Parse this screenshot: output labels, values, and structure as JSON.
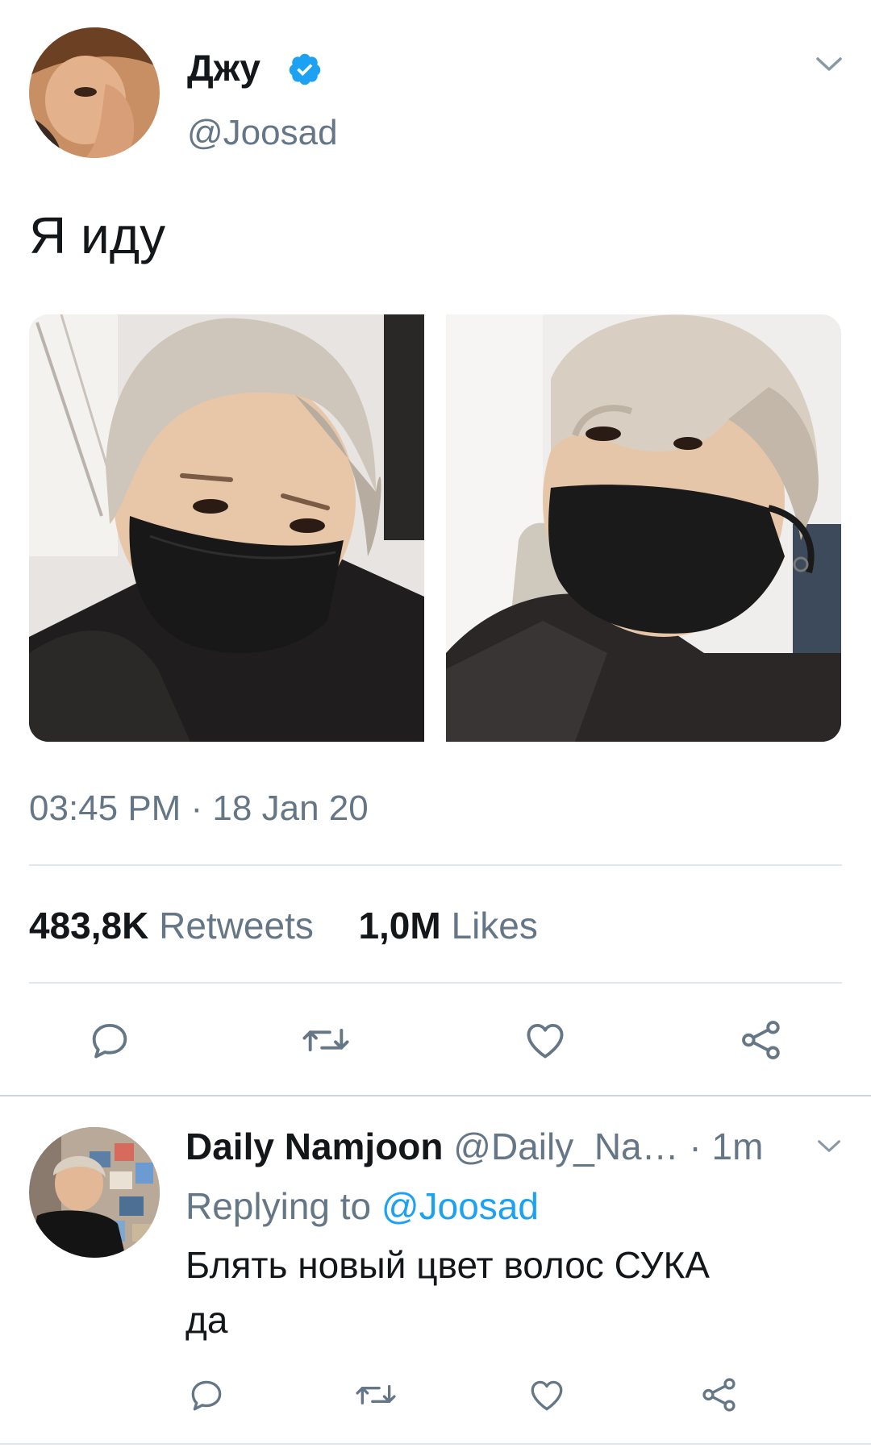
{
  "tweet": {
    "author_name": "Джу",
    "author_handle": "@Joosad",
    "verified": true,
    "text": "Я иду",
    "timestamp": "03:45 PM · 18 Jan 20",
    "retweets_count": "483,8K",
    "retweets_label": "Retweets",
    "likes_count": "1,0M",
    "likes_label": "Likes",
    "actions": [
      "reply-icon",
      "retweet-icon",
      "like-icon",
      "share-icon"
    ]
  },
  "reply": {
    "author_name": "Daily Namjoon",
    "author_handle": "@Daily_Na…",
    "time": " · 1m",
    "replying_prefix": "Replying to ",
    "replying_to": "@Joosad",
    "text_line1": "Блять новый цвет волос СУКА",
    "text_line2": "да",
    "actions": [
      "reply-icon",
      "retweet-icon",
      "like-icon",
      "share-icon"
    ]
  },
  "colors": {
    "accent": "#1da1f2",
    "muted": "#657786",
    "divider": "#e1e8ed",
    "text": "#14171a"
  }
}
